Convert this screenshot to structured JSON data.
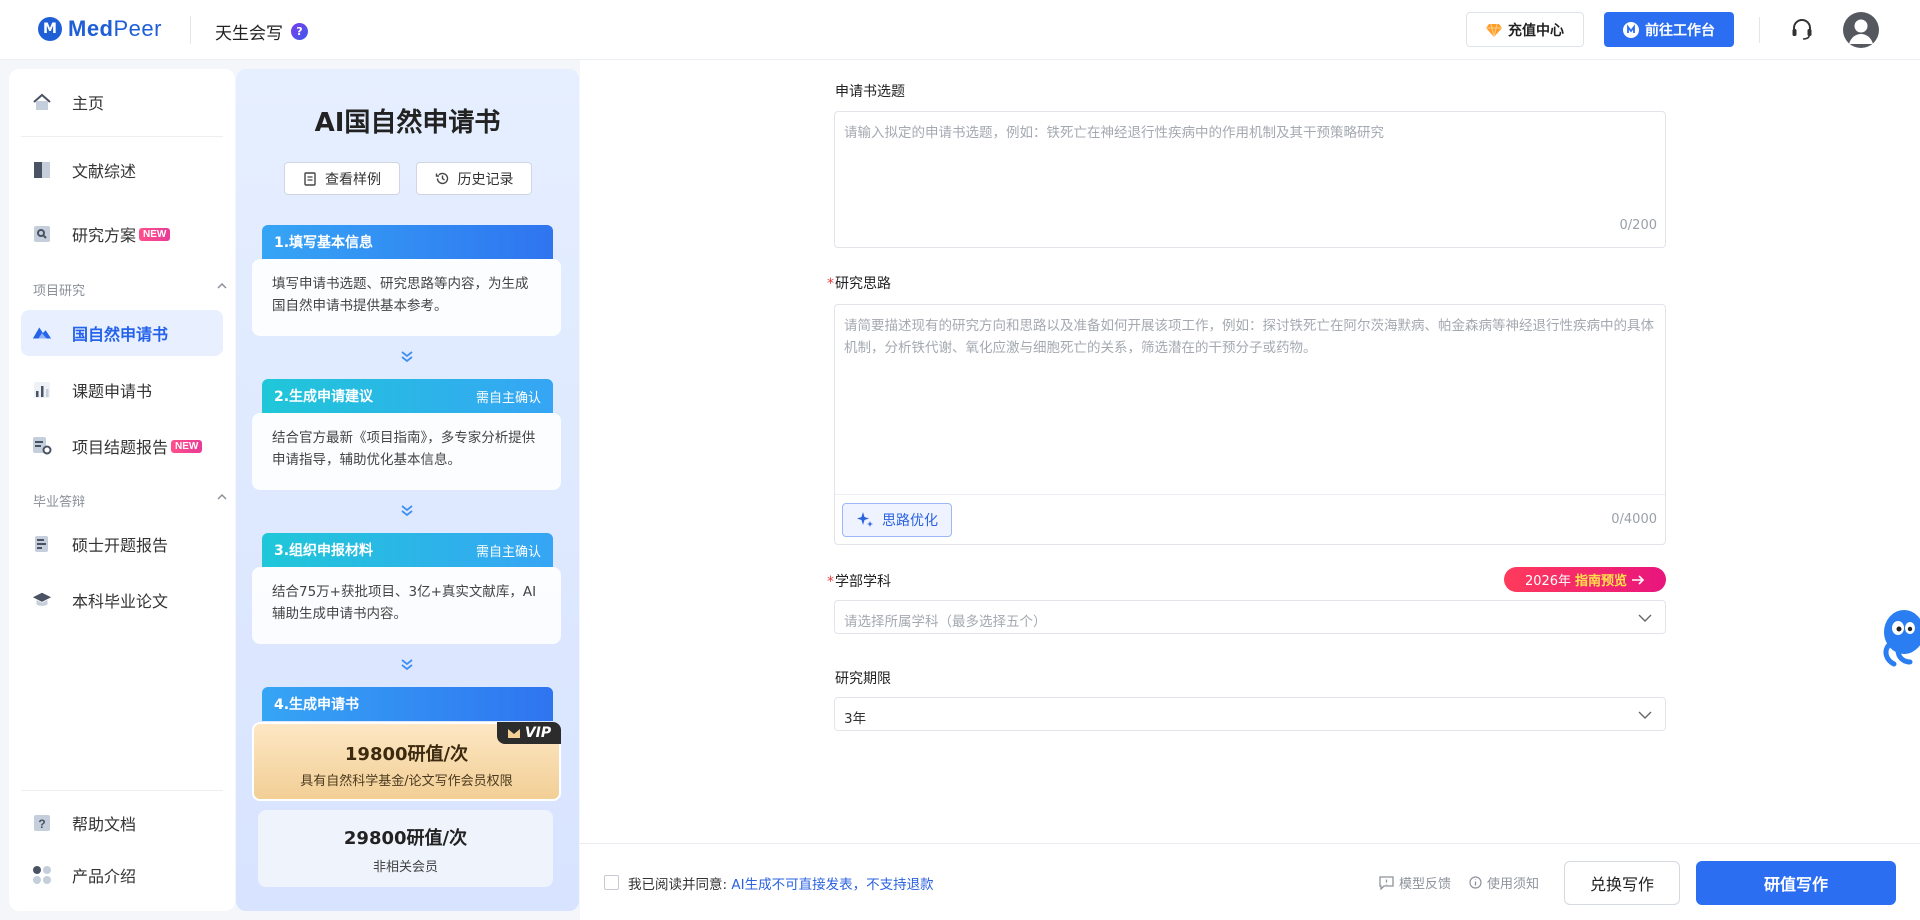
{
  "header": {
    "logo_mark": "M",
    "logo_text_bold": "Med",
    "logo_text_light": "Peer",
    "product": "天生会写",
    "help_mark": "?",
    "recharge_label": "充值中心",
    "workspace_label": "前往工作台"
  },
  "sidebar": {
    "home": "主页",
    "literature": "文献综述",
    "research_plan": "研究方案",
    "new_badge": "NEW",
    "section_project": "项目研究",
    "nsfc": "国自然申请书",
    "topic_app": "课题申请书",
    "final_report": "项目结题报告",
    "section_grad": "毕业答辩",
    "master_report": "硕士开题报告",
    "bachelor_thesis": "本科毕业论文",
    "help_docs": "帮助文档",
    "product_intro": "产品介绍"
  },
  "steps": {
    "title": "AI国自然申请书",
    "view_sample": "查看样例",
    "history": "历史记录",
    "confirm_tag": "需自主确认",
    "items": [
      {
        "title": "1.填写基本信息",
        "desc": "填写申请书选题、研究思路等内容，为生成国自然申请书提供基本参考。"
      },
      {
        "title": "2.生成申请建议",
        "desc": "结合官方最新《项目指南》，多专家分析提供申请指导，辅助优化基本信息。"
      },
      {
        "title": "3.组织申报材料",
        "desc": "结合75万+获批项目、3亿+真实文献库，AI辅助生成申请书内容。"
      },
      {
        "title": "4.生成申请书"
      }
    ],
    "vip_tag": "VIP",
    "vip_price": "19800研值/次",
    "vip_desc": "具有自然科学基金/论文写作会员权限",
    "nonvip_price": "29800研值/次",
    "nonvip_desc": "非相关会员"
  },
  "form": {
    "topic_label": "申请书选题",
    "topic_placeholder": "请输入拟定的申请书选题，例如：铁死亡在神经退行性疾病中的作用机制及其干预策略研究",
    "topic_count": "0/200",
    "required_mark": "*",
    "idea_label": "研究思路",
    "idea_placeholder": "请简要描述现有的研究方向和思路以及准备如何开展该项工作，例如：探讨铁死亡在阿尔茨海默病、帕金森病等神经退行性疾病中的具体机制，分析铁代谢、氧化应激与细胞死亡的关系，筛选潜在的干预分子或药物。",
    "idea_optimize": "思路优化",
    "idea_count": "0/4000",
    "subject_label": "学部学科",
    "subject_badge_year": "2026年",
    "subject_badge_text": "指南预览",
    "subject_placeholder": "请选择所属学科（最多选择五个）",
    "period_label": "研究期限",
    "period_value": "3年"
  },
  "footer": {
    "agree_text": "我已阅读并同意:",
    "agree_link": "AI生成不可直接发表，不支持退款",
    "feedback": "模型反馈",
    "notice": "使用须知",
    "exchange": "兑换写作",
    "write": "研值写作"
  },
  "colors": {
    "primary": "#2b6ef2",
    "badge_pink": "#e8157e",
    "vip_gold": "#f2cf95"
  }
}
